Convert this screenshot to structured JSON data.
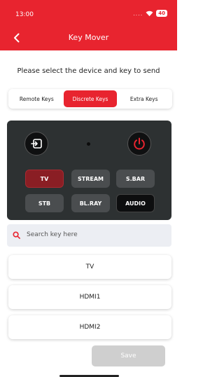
{
  "status": {
    "time": "13:00",
    "dots": "....",
    "battery": "40"
  },
  "header": {
    "title": "Key Mover"
  },
  "prompt": "Please select the device and key to send",
  "tabs": [
    {
      "label": "Remote Keys",
      "active": false
    },
    {
      "label": "Discrete Keys",
      "active": true
    },
    {
      "label": "Extra Keys",
      "active": false
    }
  ],
  "remote": {
    "buttons": [
      "TV",
      "STREAM",
      "S.BAR",
      "STB",
      "BL.RAY",
      "AUDIO"
    ],
    "icons": [
      "input-icon",
      "power-icon"
    ]
  },
  "search": {
    "placeholder": "Search key here"
  },
  "keys": [
    "TV",
    "HDMI1",
    "HDMI2"
  ],
  "footer": {
    "save_label": "Save"
  },
  "colors": {
    "accent": "#e8242f",
    "remote_body": "#2d3132",
    "tv_selected": "#8a1e24",
    "save_disabled": "#cfcfcf"
  }
}
